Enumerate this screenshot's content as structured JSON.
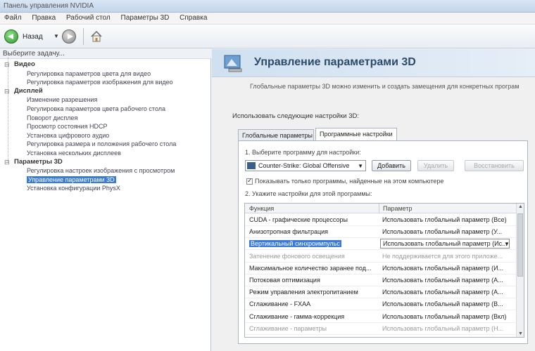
{
  "window": {
    "title": "Панель управления NVIDIA"
  },
  "menu": [
    "Файл",
    "Правка",
    "Рабочий стол",
    "Параметры 3D",
    "Справка"
  ],
  "toolbar": {
    "back_label": "Назад"
  },
  "sidebar": {
    "title": "Выберите задачу...",
    "tree": [
      {
        "type": "cat",
        "label": "Видео"
      },
      {
        "type": "leaf",
        "label": "Регулировка параметров цвета для видео"
      },
      {
        "type": "leaf",
        "label": "Регулировка параметров изображения для видео"
      },
      {
        "type": "cat",
        "label": "Дисплей"
      },
      {
        "type": "leaf",
        "label": "Изменение разрешения"
      },
      {
        "type": "leaf",
        "label": "Регулировка параметров цвета рабочего стола"
      },
      {
        "type": "leaf",
        "label": "Поворот дисплея"
      },
      {
        "type": "leaf",
        "label": "Просмотр состояния HDCP"
      },
      {
        "type": "leaf",
        "label": "Установка цифрового аудио"
      },
      {
        "type": "leaf",
        "label": "Регулировка размера и положения рабочего стола"
      },
      {
        "type": "leaf",
        "label": "Установка нескольких дисплеев"
      },
      {
        "type": "cat",
        "label": "Параметры 3D"
      },
      {
        "type": "leaf",
        "label": "Регулировка настроек изображения с просмотром"
      },
      {
        "type": "leaf",
        "label": "Управление параметрами 3D",
        "selected": true
      },
      {
        "type": "leaf",
        "label": "Установка конфигурации PhysX"
      }
    ]
  },
  "main": {
    "title": "Управление параметрами 3D",
    "description": "Глобальные параметры 3D можно изменить и создать замещения для конкретных програм",
    "settings_label": "Использовать следующие настройки 3D:",
    "tabs": [
      "Глобальные параметры",
      "Программные настройки"
    ],
    "active_tab": 1,
    "step1": "1. Выберите программу для настройки:",
    "program": "Counter-Strike: Global Offensive",
    "add_button": "Добавить",
    "remove_button": "Удалить",
    "restore_button": "Восстановить",
    "checkbox_label": "Показывать только программы, найденные на этом компьютере",
    "checkbox_checked": true,
    "step2": "2. Укажите настройки для этой программы:",
    "table": {
      "headers": [
        "Функция",
        "Параметр"
      ],
      "rows": [
        {
          "f": "CUDA - графические процессоры",
          "p": "Использовать глобальный параметр (Все)",
          "state": "normal"
        },
        {
          "f": "Анизотропная фильтрация",
          "p": "Использовать глобальный параметр (У...",
          "state": "normal"
        },
        {
          "f": "Вертикальный синхроимпульс",
          "p": "Использовать глобальный параметр (Ис...",
          "state": "selected"
        },
        {
          "f": "Затенение фонового освещения",
          "p": "Не поддерживается для этого приложе...",
          "state": "dim"
        },
        {
          "f": "Максимальное количество заранее под...",
          "p": "Использовать глобальный параметр (И...",
          "state": "normal"
        },
        {
          "f": "Потоковая оптимизация",
          "p": "Использовать глобальный параметр (А...",
          "state": "normal"
        },
        {
          "f": "Режим управления электропитанием",
          "p": "Использовать глобальный параметр (А...",
          "state": "normal"
        },
        {
          "f": "Сглаживание - FXAA",
          "p": "Использовать глобальный параметр (В...",
          "state": "normal"
        },
        {
          "f": "Сглаживание - гамма-коррекция",
          "p": "Использовать глобальный параметр (Вкл)",
          "state": "normal"
        },
        {
          "f": "Сглаживание - параметры",
          "p": "Использовать глобальный параметр (Н...",
          "state": "dim"
        }
      ]
    }
  }
}
